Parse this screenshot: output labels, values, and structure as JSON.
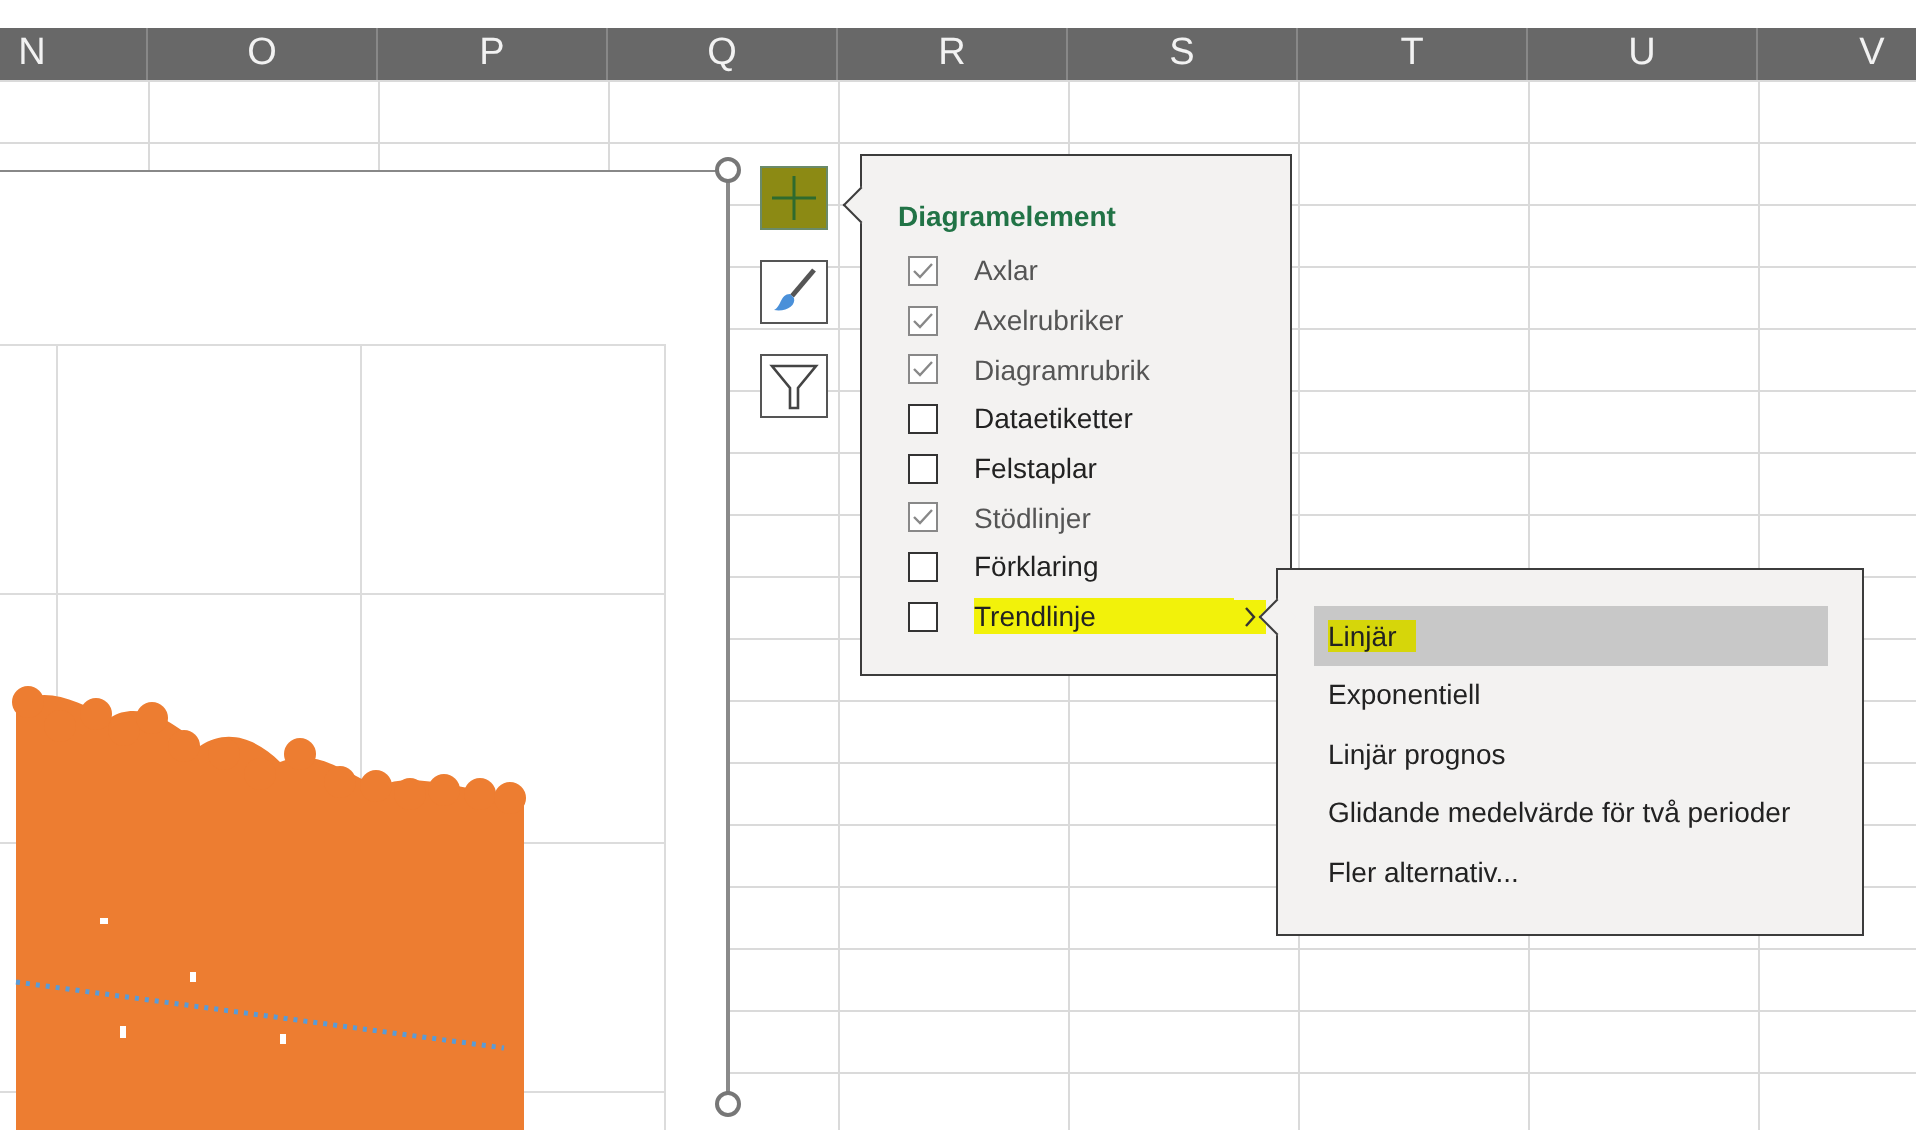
{
  "sheet": {
    "columns": [
      "N",
      "O",
      "P",
      "Q",
      "R",
      "S",
      "T",
      "U",
      "V"
    ]
  },
  "chart_buttons": [
    {
      "kind": "elements",
      "highlighted": true
    },
    {
      "kind": "styles",
      "highlighted": false
    },
    {
      "kind": "filters",
      "highlighted": false
    }
  ],
  "chart_elements_menu": {
    "title": "Diagramelement",
    "items": [
      {
        "label": "Axlar",
        "checked": true,
        "highlighted": false,
        "has_submenu": false
      },
      {
        "label": "Axelrubriker",
        "checked": true,
        "highlighted": false,
        "has_submenu": false
      },
      {
        "label": "Diagramrubrik",
        "checked": true,
        "highlighted": false,
        "has_submenu": false
      },
      {
        "label": "Dataetiketter",
        "checked": false,
        "highlighted": false,
        "has_submenu": false
      },
      {
        "label": "Felstaplar",
        "checked": false,
        "highlighted": false,
        "has_submenu": false
      },
      {
        "label": "Stödlinjer",
        "checked": true,
        "highlighted": false,
        "has_submenu": false
      },
      {
        "label": "Förklaring",
        "checked": false,
        "highlighted": false,
        "has_submenu": false
      },
      {
        "label": "Trendlinje",
        "checked": false,
        "highlighted": true,
        "has_submenu": true
      }
    ]
  },
  "trendline_submenu": {
    "items": [
      {
        "label": "Linjär",
        "selected": true,
        "highlighted": true
      },
      {
        "label": "Exponentiell",
        "selected": false,
        "highlighted": false
      },
      {
        "label": "Linjär prognos",
        "selected": false,
        "highlighted": false
      },
      {
        "label": "Glidande medelvärde för två perioder",
        "selected": false,
        "highlighted": false
      },
      {
        "label": "Fler alternativ...",
        "selected": false,
        "highlighted": false
      }
    ]
  }
}
